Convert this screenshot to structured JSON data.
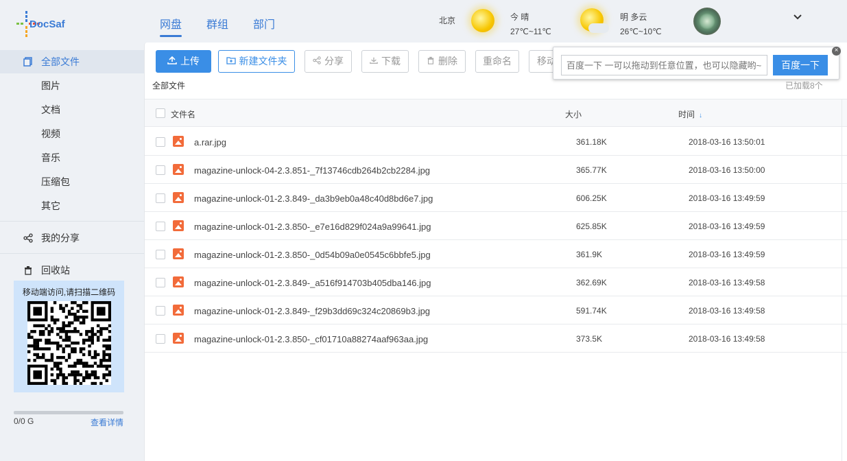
{
  "app": {
    "logo_text": "DocSaf"
  },
  "nav": {
    "tabs": [
      {
        "label": "网盘",
        "active": true
      },
      {
        "label": "群组",
        "active": false
      },
      {
        "label": "部门",
        "active": false
      }
    ]
  },
  "weather": {
    "city": "北京",
    "today": {
      "label": "今 晴",
      "temp": "27℃~11℃",
      "icon": "sunny-icon"
    },
    "tomorrow": {
      "label": "明 多云",
      "temp": "26℃~10℃",
      "icon": "partly-cloudy-icon"
    }
  },
  "sidebar": {
    "all_files": "全部文件",
    "categories": [
      "图片",
      "文档",
      "视频",
      "音乐",
      "压缩包",
      "其它"
    ],
    "my_share": "我的分享",
    "recycle_bin": "回收站",
    "qr_title": "移动端访问,请扫描二维码",
    "storage_text": "0/0 G",
    "storage_link": "查看详情",
    "storage_used_fraction": 0
  },
  "toolbar": {
    "upload": "上传",
    "new_folder": "新建文件夹",
    "share": "分享",
    "download": "下载",
    "delete": "删除",
    "rename": "重命名",
    "move": "移动"
  },
  "search": {
    "placeholder": "百度一下 一可以拖动到任意位置，也可以隐藏哟~",
    "button": "百度一下",
    "close": "×"
  },
  "breadcrumb": "全部文件",
  "loaded_text": "已加载8个",
  "table": {
    "headers": {
      "name": "文件名",
      "size": "大小",
      "time": "时间"
    },
    "sort_indicator": "↓",
    "rows": [
      {
        "name": "a.rar.jpg",
        "size": "361.18K",
        "time": "2018-03-16 13:50:01"
      },
      {
        "name": "magazine-unlock-04-2.3.851-_7f13746cdb264b2cb2284.jpg",
        "size": "365.77K",
        "time": "2018-03-16 13:50:00"
      },
      {
        "name": "magazine-unlock-01-2.3.849-_da3b9eb0a48c40d8bd6e7.jpg",
        "size": "606.25K",
        "time": "2018-03-16 13:49:59"
      },
      {
        "name": "magazine-unlock-01-2.3.850-_e7e16d829f024a9a99641.jpg",
        "size": "625.85K",
        "time": "2018-03-16 13:49:59"
      },
      {
        "name": "magazine-unlock-01-2.3.850-_0d54b09a0e0545c6bbfe5.jpg",
        "size": "361.9K",
        "time": "2018-03-16 13:49:59"
      },
      {
        "name": "magazine-unlock-01-2.3.849-_a516f914703b405dba146.jpg",
        "size": "362.69K",
        "time": "2018-03-16 13:49:58"
      },
      {
        "name": "magazine-unlock-01-2.3.849-_f29b3dd69c324c20869b3.jpg",
        "size": "591.74K",
        "time": "2018-03-16 13:49:58"
      },
      {
        "name": "magazine-unlock-01-2.3.850-_cf01710a88274aaf963aa.jpg",
        "size": "373.5K",
        "time": "2018-03-16 13:49:58"
      }
    ]
  }
}
